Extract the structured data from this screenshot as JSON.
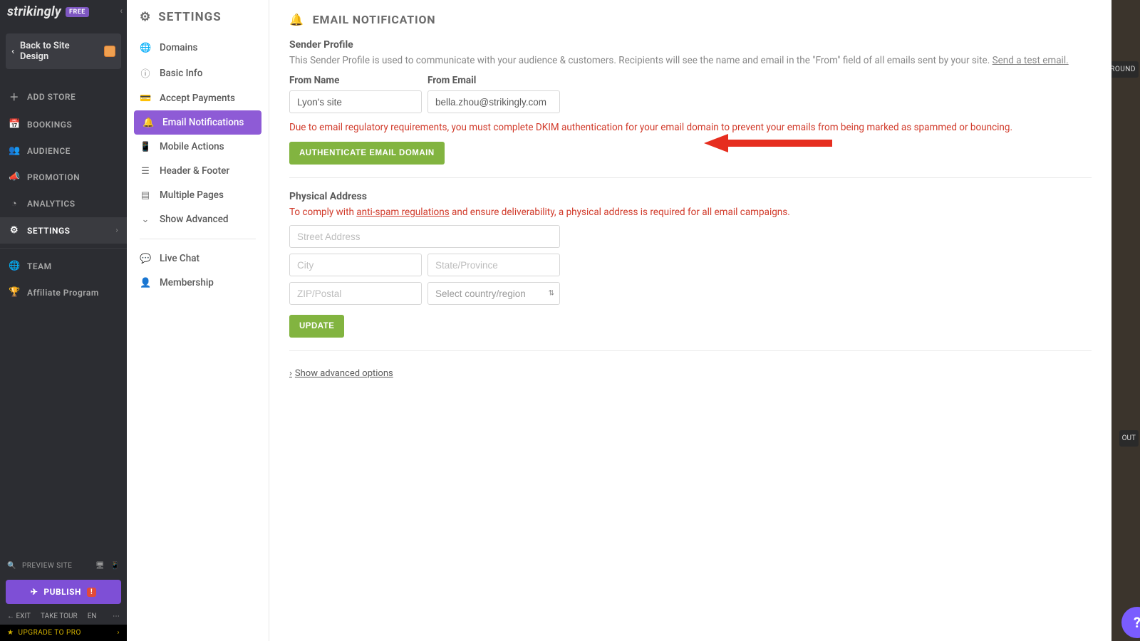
{
  "brand": {
    "name": "strikingly",
    "badge": "FREE"
  },
  "back_button": "Back to Site Design",
  "left_nav": [
    {
      "icon": "＋",
      "label": "ADD STORE"
    },
    {
      "icon": "📅",
      "label": "BOOKINGS"
    },
    {
      "icon": "👥",
      "label": "AUDIENCE"
    },
    {
      "icon": "📣",
      "label": "PROMOTION"
    },
    {
      "icon": "◔",
      "label": "ANALYTICS"
    },
    {
      "icon": "⚙",
      "label": "SETTINGS",
      "active": true,
      "chev": "›"
    }
  ],
  "left_nav2": [
    {
      "icon": "🌐",
      "label": "TEAM"
    },
    {
      "icon": "🏆",
      "label": "Affiliate Program"
    }
  ],
  "preview_label": "PREVIEW SITE",
  "publish_label": "PUBLISH",
  "publish_alert": "!",
  "bottom": {
    "exit": "EXIT",
    "tour": "TAKE TOUR",
    "lang": "EN"
  },
  "upgrade": "UPGRADE TO PRO",
  "settings_panel": {
    "title": "SETTINGS",
    "items": [
      {
        "icon": "🌐",
        "label": "Domains"
      },
      {
        "icon": "ⓘ",
        "label": "Basic Info"
      },
      {
        "icon": "💳",
        "label": "Accept Payments"
      },
      {
        "icon": "🔔",
        "label": "Email Notifications",
        "active": true
      },
      {
        "icon": "📱",
        "label": "Mobile Actions"
      },
      {
        "icon": "☰",
        "label": "Header & Footer"
      },
      {
        "icon": "▤",
        "label": "Multiple Pages"
      },
      {
        "icon": "⌄",
        "label": "Show Advanced"
      }
    ],
    "items2": [
      {
        "icon": "💬",
        "label": "Live Chat"
      },
      {
        "icon": "👤",
        "label": "Membership"
      }
    ]
  },
  "main": {
    "heading": "EMAIL NOTIFICATION",
    "sender_profile": {
      "title": "Sender Profile",
      "help_pre": "This Sender Profile is used to communicate with your audience & customers. Recipients will see the name and email in the \"From\" field of all emails sent by your site. ",
      "help_link": "Send a test email.",
      "from_name_label": "From Name",
      "from_name_value": "Lyon's site",
      "from_email_label": "From Email",
      "from_email_value": "bella.zhou@strikingly.com",
      "dkim_warning": "Due to email regulatory requirements, you must complete DKIM authentication for your email domain to prevent your emails from being marked as spammed or bouncing.",
      "auth_button": "AUTHENTICATE EMAIL DOMAIN"
    },
    "physical_address": {
      "title": "Physical Address",
      "req_pre": "To comply with ",
      "req_link": "anti-spam regulations",
      "req_post": " and ensure deliverability, a physical address is required for all email campaigns.",
      "street_ph": "Street Address",
      "city_ph": "City",
      "state_ph": "State/Province",
      "zip_ph": "ZIP/Postal",
      "country_ph": "Select country/region",
      "update_btn": "UPDATE"
    },
    "advanced_link": " Show advanced options"
  },
  "rightstrip": {
    "round": "ROUND",
    "out": "OUT",
    "help": "?"
  }
}
